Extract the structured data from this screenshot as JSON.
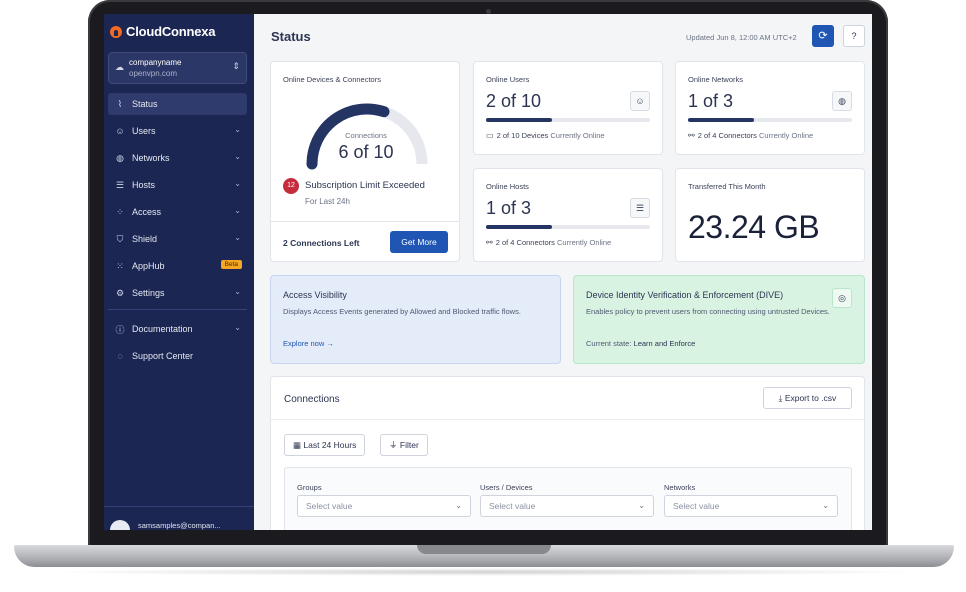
{
  "app": {
    "brand": "CloudConnexa",
    "org_name": "companyname",
    "org_domain": "openvpn.com",
    "user_email": "samsamples@compan..."
  },
  "sidebar": {
    "items": [
      {
        "label": "Status",
        "icon": "status-icon",
        "active": true
      },
      {
        "label": "Users",
        "icon": "users-icon",
        "expandable": true
      },
      {
        "label": "Networks",
        "icon": "globe-icon",
        "expandable": true
      },
      {
        "label": "Hosts",
        "icon": "server-icon",
        "expandable": true
      },
      {
        "label": "Access",
        "icon": "grid-icon",
        "expandable": true
      },
      {
        "label": "Shield",
        "icon": "shield-icon",
        "expandable": true
      },
      {
        "label": "AppHub",
        "icon": "apphub-icon",
        "badge": "Beta"
      },
      {
        "label": "Settings",
        "icon": "gear-icon",
        "expandable": true
      }
    ],
    "secondary": [
      {
        "label": "Documentation",
        "icon": "info-icon",
        "expandable": true
      },
      {
        "label": "Support Center",
        "icon": "chat-icon"
      }
    ]
  },
  "header": {
    "title": "Status",
    "updated": "Updated Jun 8, 12:00 AM UTC+2"
  },
  "devices": {
    "label": "Online Devices & Connectors",
    "gauge_sub": "Connections",
    "gauge_value": "6 of 10",
    "gauge_fraction": 0.6,
    "limit_badge": "12",
    "limit_text": "Subscription Limit Exceeded",
    "limit_period": "For Last 24h",
    "connections_left": "2 Connections Left",
    "get_more": "Get More"
  },
  "online_users": {
    "label": "Online Users",
    "value": "2 of 10",
    "fraction": 0.4,
    "foot_strong": "2 of 10 Devices",
    "foot_muted": "Currently Online"
  },
  "online_networks": {
    "label": "Online Networks",
    "value": "1 of 3",
    "fraction": 0.4,
    "foot_strong": "2 of 4 Connectors",
    "foot_muted": "Currently Online"
  },
  "online_hosts": {
    "label": "Online Hosts",
    "value": "1 of 3",
    "fraction": 0.4,
    "foot_strong": "2 of 4 Connectors",
    "foot_muted": "Currently Online"
  },
  "transferred": {
    "label": "Transferred This Month",
    "value": "23.24 GB"
  },
  "access_visibility": {
    "title": "Access Visibility",
    "desc": "Displays Access Events generated by Allowed and Blocked traffic flows.",
    "link": "Explore now →"
  },
  "dive": {
    "title": "Device Identity Verification & Enforcement (DIVE)",
    "desc": "Enables policy to prevent users from connecting using untrusted Devices.",
    "state_label": "Current state:",
    "state_value": "Learn and Enforce"
  },
  "connections": {
    "title": "Connections",
    "export": "Export to .csv",
    "range": "Last 24 Hours",
    "filter": "Filter",
    "filters": [
      {
        "label": "Groups",
        "placeholder": "Select value"
      },
      {
        "label": "Users / Devices",
        "placeholder": "Select value"
      },
      {
        "label": "Networks",
        "placeholder": "Select value"
      }
    ]
  },
  "colors": {
    "sidebar": "#1b2653",
    "primary": "#1f55b3",
    "gauge": "#243463",
    "alert": "#c62c3b",
    "beta": "#f5a623"
  }
}
